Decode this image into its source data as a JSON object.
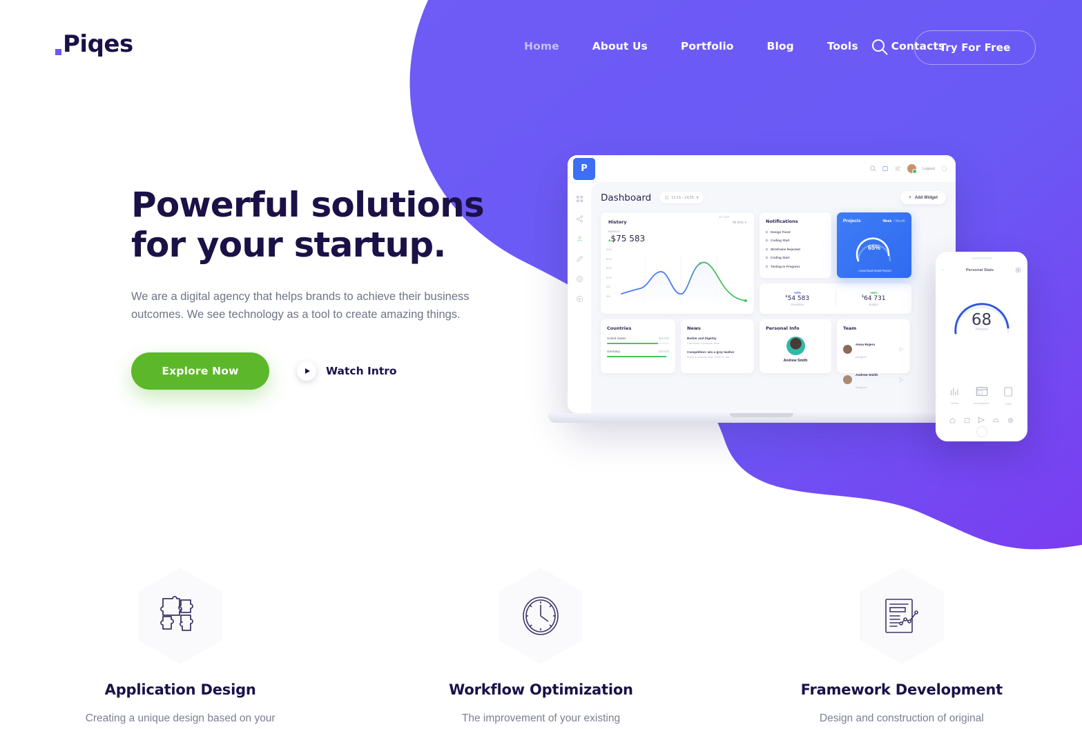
{
  "brand": {
    "name": "Piqes",
    "accent": "#6a5af5",
    "dark": "#1b1147",
    "green": "#5cb82a"
  },
  "header": {
    "nav": [
      {
        "label": "Home",
        "active": true
      },
      {
        "label": "About Us",
        "active": false
      },
      {
        "label": "Portfolio",
        "active": false
      },
      {
        "label": "Blog",
        "active": false
      },
      {
        "label": "Tools",
        "active": false
      },
      {
        "label": "Contacts",
        "active": false
      }
    ],
    "search_icon": "search-icon",
    "cta_label": "Try For Free"
  },
  "hero": {
    "title_line1": "Powerful solutions",
    "title_line2": "for your startup.",
    "paragraph": "We are a digital agency that helps brands to achieve their business outcomes. We see technology as a tool to create amazing things.",
    "primary_button": "Explore Now",
    "secondary_button": "Watch Intro"
  },
  "dashboard": {
    "logo_letter": "P",
    "logout_label": "Logout",
    "title": "Dashboard",
    "date_range": "13:15 - 14:25",
    "add_widget": "Add Widget",
    "history": {
      "title": "History",
      "filter": "All time",
      "balance_label": "Balance",
      "balance_value": "$75 583",
      "tooltip": "$77 534",
      "y_labels": [
        "$25k",
        "$20k",
        "$15k",
        "$10k",
        "$5k",
        "$0k"
      ]
    },
    "notifications": {
      "title": "Notifications",
      "items": [
        "Design Fixed",
        "Coding Start",
        "Wireframe Rejected",
        "Coding Start",
        "Testing In Progress"
      ]
    },
    "projects": {
      "title": "Projects",
      "tab_week": "Week",
      "tab_month": "/ Month",
      "percent": "65%",
      "download_label": "Download Detail Report"
    },
    "stats": [
      {
        "delta": "+25%",
        "value": "54 583",
        "currency": "$",
        "label": "Investition",
        "color": "blue"
      },
      {
        "delta": "+66%",
        "value": "64 731",
        "currency": "$",
        "label": "Budget",
        "color": "green"
      }
    ],
    "countries": {
      "title": "Countries",
      "rows": [
        {
          "name": "United States",
          "value": "$29 000",
          "percent": 82
        },
        {
          "name": "Germany",
          "value": "$18 600",
          "percent": 95
        }
      ]
    },
    "news": {
      "title": "News",
      "items": [
        {
          "title": "Barber and Digerby",
          "desc": "Commodo a posuere vitae"
        },
        {
          "title": "Competition: win a grey leather",
          "desc": "Morbi a posuere vitae nisan in risu"
        }
      ]
    },
    "personal": {
      "title": "Personal Info",
      "name": "Andrew Smith"
    },
    "team": {
      "title": "Team",
      "members": [
        {
          "name": "Anna Rojers",
          "role": "Designer"
        },
        {
          "name": "Andrew Smith",
          "role": "Designer"
        }
      ]
    }
  },
  "phone": {
    "title": "Personal Stats",
    "value": "68",
    "unit": "Percent",
    "tabs": [
      "Online",
      "Development",
      "Other"
    ]
  },
  "features": [
    {
      "icon": "puzzle-icon",
      "title": "Application Design",
      "desc": "Creating a unique design based on your"
    },
    {
      "icon": "clock-icon",
      "title": "Workflow Optimization",
      "desc": "The improvement of your existing"
    },
    {
      "icon": "document-chart-icon",
      "title": "Framework Development",
      "desc": "Design and construction of original"
    }
  ],
  "chart_data": {
    "type": "line",
    "title": "History",
    "ylabel": "",
    "xlabel": "",
    "y_ticks": [
      "$25k",
      "$20k",
      "$15k",
      "$10k",
      "$5k",
      "$0k"
    ],
    "ylim": [
      0,
      25000
    ],
    "grid": true,
    "annotations": [
      "$77 534"
    ],
    "series": [
      {
        "name": "Balance",
        "values": [
          7000,
          8200,
          8600,
          14500,
          16000,
          12000,
          6500,
          5200,
          9000,
          18000,
          21000,
          20500,
          14000,
          7500,
          5600
        ]
      }
    ]
  }
}
